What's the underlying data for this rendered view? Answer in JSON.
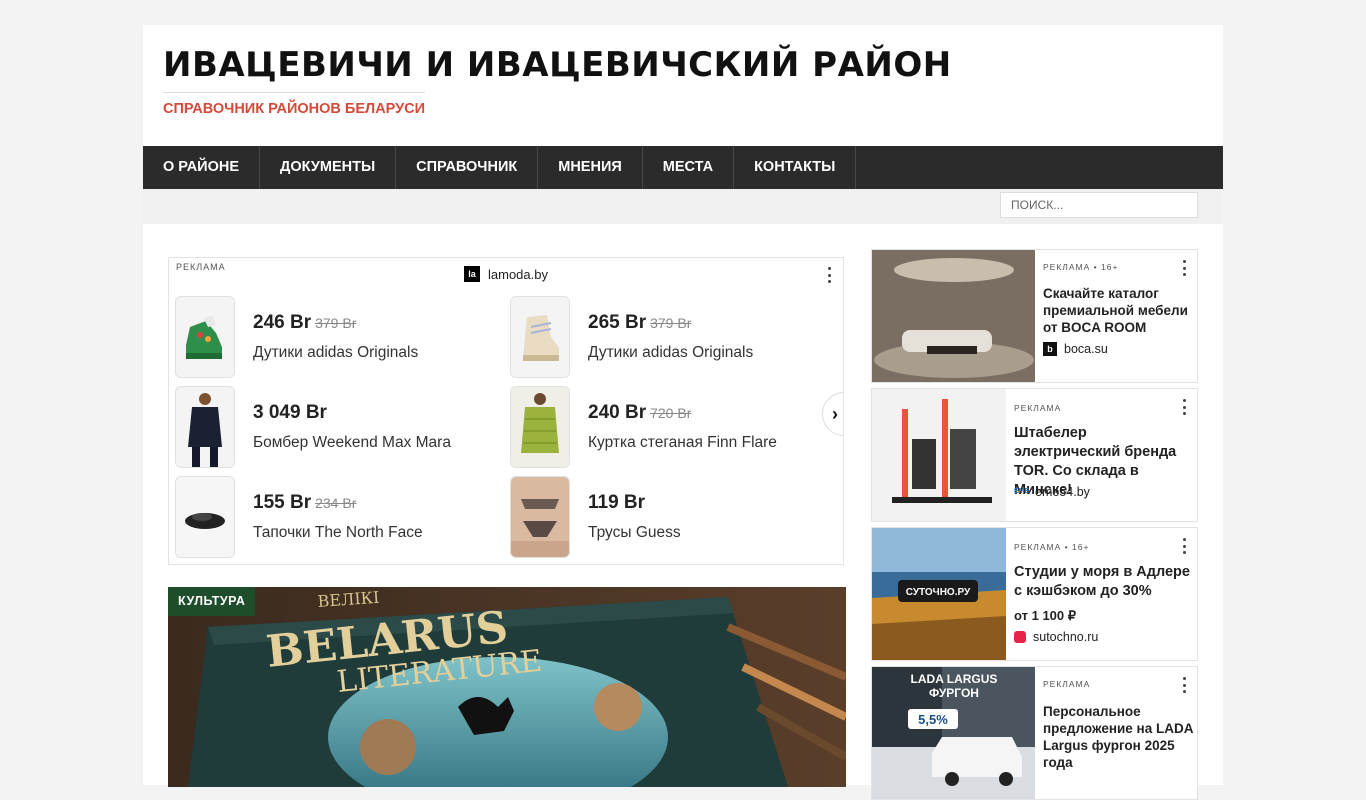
{
  "header": {
    "site_title": "ИВАЦЕВИЧИ И ИВАЦЕВИЧСКИЙ РАЙОН",
    "tagline": "СПРАВОЧНИК РАЙОНОВ БЕЛАРУСИ"
  },
  "nav": {
    "items": [
      {
        "label": "О РАЙОНЕ"
      },
      {
        "label": "ДОКУМЕНТЫ"
      },
      {
        "label": "СПРАВОЧНИК"
      },
      {
        "label": "МНЕНИЯ"
      },
      {
        "label": "МЕСТА"
      },
      {
        "label": "КОНТАКТЫ"
      }
    ]
  },
  "search": {
    "placeholder": "ПОИСК..."
  },
  "ad_left": {
    "label": "РЕКЛАМА",
    "brand_logo": "la",
    "brand": "lamoda.by",
    "products": [
      {
        "price": "246 Br",
        "old_price": "379 Br",
        "name": "Дутики adidas Originals"
      },
      {
        "price": "265 Br",
        "old_price": "379 Br",
        "name": "Дутики adidas Originals"
      },
      {
        "price": "3 049 Br",
        "old_price": "",
        "name": "Бомбер Weekend Max Mara"
      },
      {
        "price": "240 Br",
        "old_price": "720 Br",
        "name": "Куртка стеганая Finn Flare"
      },
      {
        "price": "155 Br",
        "old_price": "234 Br",
        "name": "Тапочки The North Face"
      },
      {
        "price": "119 Br",
        "old_price": "",
        "name": "Трусы Guess"
      }
    ],
    "next_glyph": "›"
  },
  "article": {
    "category": "КУЛЬТУРА",
    "book_title_1": "BELARUS",
    "book_title_2": "LITERATURE",
    "book_top": "ВЕЛІКІ"
  },
  "ads_right": [
    {
      "label": "РЕКЛАМА • 16+",
      "title": "Скачайте каталог премиальной мебели от BOCA ROOM",
      "price": "",
      "domain_logo": "b",
      "domain": "boca.su"
    },
    {
      "label": "РЕКЛАМА",
      "title": "Штабелер электрический бренда TOR. Со склада в Минске!",
      "price": "",
      "domain_logo": "EME",
      "domain": "eme54.by"
    },
    {
      "label": "РЕКЛАМА • 16+",
      "title": "Студии у моря в Адлере с кэшбэком до 30%",
      "price": "от 1 100 ₽",
      "domain_logo": "",
      "domain": "sutochno.ru",
      "image_text": "СУТОЧНО.РУ"
    },
    {
      "label": "РЕКЛАМА",
      "title": "Персональное предложение на LADA Largus фургон 2025 года",
      "price": "",
      "domain_logo": "",
      "domain": "",
      "image_text_1": "LADA LARGUS",
      "image_text_2": "ФУРГОН",
      "image_text_3": "5,5%"
    }
  ],
  "colors": {
    "accent": "#d44a3a",
    "nav_bg": "#2b2b2b",
    "badge_bg": "#1e4d2b"
  }
}
